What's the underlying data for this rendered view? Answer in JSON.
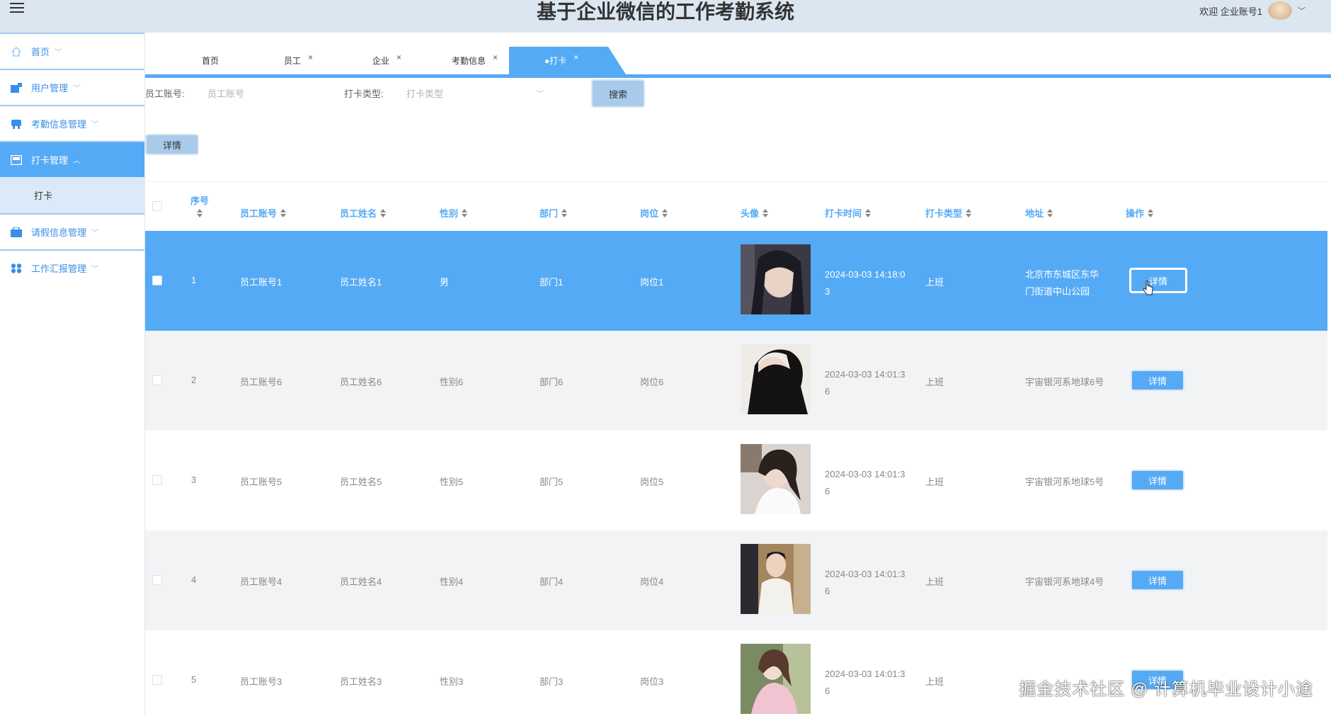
{
  "header": {
    "title": "基于企业微信的工作考勤系统",
    "welcome": "欢迎 企业账号1"
  },
  "sidebar": {
    "items": [
      {
        "label": "首页",
        "icon": "home-icon"
      },
      {
        "label": "用户管理",
        "icon": "user-manage-icon"
      },
      {
        "label": "考勤信息管理",
        "icon": "attendance-icon"
      },
      {
        "label": "打卡管理",
        "icon": "clock-in-icon"
      },
      {
        "label": "打卡"
      },
      {
        "label": "请假信息管理",
        "icon": "leave-icon"
      },
      {
        "label": "工作汇报管理",
        "icon": "report-icon"
      }
    ]
  },
  "tabs": [
    {
      "label": "首页"
    },
    {
      "label": "员工"
    },
    {
      "label": "企业"
    },
    {
      "label": "考勤信息"
    },
    {
      "label": "●打卡"
    }
  ],
  "search": {
    "account_label": "员工账号:",
    "account_placeholder": "员工账号",
    "type_label": "打卡类型:",
    "type_placeholder": "打卡类型",
    "search_button": "搜索",
    "detail_button": "详情"
  },
  "table": {
    "columns": [
      "序号",
      "员工账号",
      "员工姓名",
      "性别",
      "部门",
      "岗位",
      "头像",
      "打卡时间",
      "打卡类型",
      "地址",
      "操作"
    ],
    "detail_label": "详情",
    "rows": [
      {
        "seq": "1",
        "account": "员工账号1",
        "name": "员工姓名1",
        "gender": "男",
        "dept": "部门1",
        "post": "岗位1",
        "time1": "2024-03-03 14:18:0",
        "time2": "3",
        "type": "上班",
        "addr1": "北京市东城区东华",
        "addr2": "门街道中山公园"
      },
      {
        "seq": "2",
        "account": "员工账号6",
        "name": "员工姓名6",
        "gender": "性别6",
        "dept": "部门6",
        "post": "岗位6",
        "time1": "2024-03-03 14:01:3",
        "time2": "6",
        "type": "上班",
        "addr1": "宇宙银河系地球6号",
        "addr2": ""
      },
      {
        "seq": "3",
        "account": "员工账号5",
        "name": "员工姓名5",
        "gender": "性别5",
        "dept": "部门5",
        "post": "岗位5",
        "time1": "2024-03-03 14:01:3",
        "time2": "6",
        "type": "上班",
        "addr1": "宇宙银河系地球5号",
        "addr2": ""
      },
      {
        "seq": "4",
        "account": "员工账号4",
        "name": "员工姓名4",
        "gender": "性别4",
        "dept": "部门4",
        "post": "岗位4",
        "time1": "2024-03-03 14:01:3",
        "time2": "6",
        "type": "上班",
        "addr1": "宇宙银河系地球4号",
        "addr2": ""
      },
      {
        "seq": "5",
        "account": "员工账号3",
        "name": "员工姓名3",
        "gender": "性别3",
        "dept": "部门3",
        "post": "岗位3",
        "time1": "2024-03-03 14:01:3",
        "time2": "6",
        "type": "上班",
        "addr1": "",
        "addr2": ""
      }
    ]
  },
  "watermark": "掘金技术社区 @ 计算机毕业设计小途",
  "colors": {
    "accent": "#55aaf5",
    "header_bg": "#dbe6f1"
  }
}
